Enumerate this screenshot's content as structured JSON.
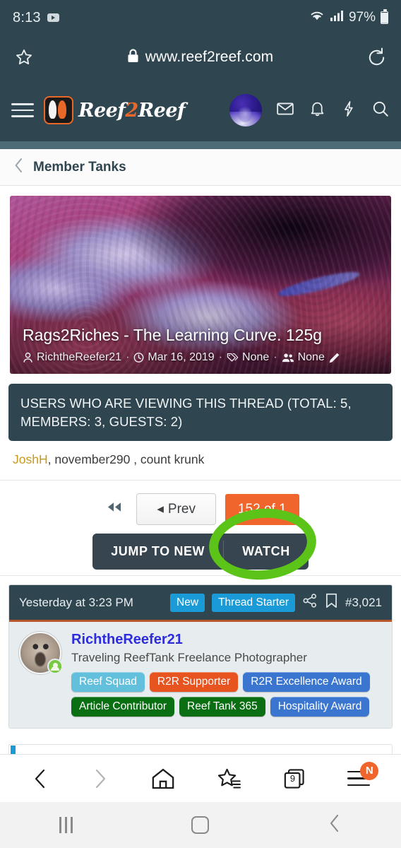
{
  "status_bar": {
    "time": "8:13",
    "battery_percent": "97%",
    "icons": [
      "youtube-icon",
      "wifi-icon",
      "signal-icon",
      "battery-icon"
    ]
  },
  "browser": {
    "url": "www.reef2reef.com",
    "lock_icon": "lock-icon",
    "star_icon": "star-icon",
    "reload_icon": "reload-icon",
    "bottom_toolbar": {
      "back_icon": "back-arrow-icon",
      "forward_icon": "forward-arrow-icon",
      "home_icon": "home-icon",
      "bookmarks_icon": "star-list-icon",
      "tabs_icon": "tabs-icon",
      "tab_count": "9",
      "menu_icon": "menu-icon",
      "menu_badge": "N"
    }
  },
  "site_header": {
    "menu_icon": "hamburger-menu-icon",
    "logo_text_1": "Reef",
    "logo_text_2": "2",
    "logo_text_3": "Reef",
    "avatar": "user-avatar",
    "mail_icon": "envelope-icon",
    "bell_icon": "bell-icon",
    "bolt_icon": "lightning-bolt-icon",
    "search_icon": "search-icon"
  },
  "breadcrumb": {
    "back_icon": "chevron-left-icon",
    "label": "Member Tanks"
  },
  "thread": {
    "title": "Rags2Riches - The Learning Curve. 125g",
    "author": "RichtheReefer21",
    "date": "Mar 16, 2019",
    "tags": "None",
    "category": "None",
    "author_icon": "person-icon",
    "clock_icon": "clock-icon",
    "tag_icon": "tag-icon",
    "group_icon": "people-icon",
    "edit_icon": "pencil-icon",
    "separator": "·"
  },
  "viewing_banner": {
    "text": "USERS WHO ARE VIEWING THIS THREAD (TOTAL: 5, MEMBERS: 3, GUESTS: 2)",
    "viewer_highlight": "JoshH",
    "viewers_rest": ", november290 , count krunk"
  },
  "pagination": {
    "first_icon": "rewind-icon",
    "prev_label": "Prev",
    "prev_arrow": "◂",
    "page_count": "152 of 1",
    "jump_to_new": "JUMP TO NEW",
    "watch": "WATCH",
    "annotation": "green-circle-highlight",
    "accent_color": "#f0652b",
    "annotation_color": "#5cc419"
  },
  "post": {
    "date": "Yesterday at 3:23 PM",
    "new_chip": "New",
    "thread_starter_chip": "Thread Starter",
    "share_icon": "share-icon",
    "bookmark_icon": "bookmark-icon",
    "post_number": "#3,021",
    "username": "RichtheReefer21",
    "user_title": "Traveling ReefTank Freelance Photographer",
    "avatar": "pug-avatar",
    "online_icon": "online-status-icon",
    "badges": [
      {
        "label": "Reef Squad",
        "color": "#63c0dd"
      },
      {
        "label": "R2R Supporter",
        "color": "#e8541f"
      },
      {
        "label": "R2R Excellence Award",
        "color": "#3a76d0"
      },
      {
        "label": "Article Contributor",
        "color": "#0a6e12"
      },
      {
        "label": "Reef Tank 365",
        "color": "#0a6e12"
      },
      {
        "label": "Hospitality Award",
        "color": "#3a76d0"
      }
    ]
  },
  "android_nav": {
    "recents_icon": "recents-icon",
    "home_icon": "home-square-icon",
    "back_icon": "back-chevron-icon"
  }
}
